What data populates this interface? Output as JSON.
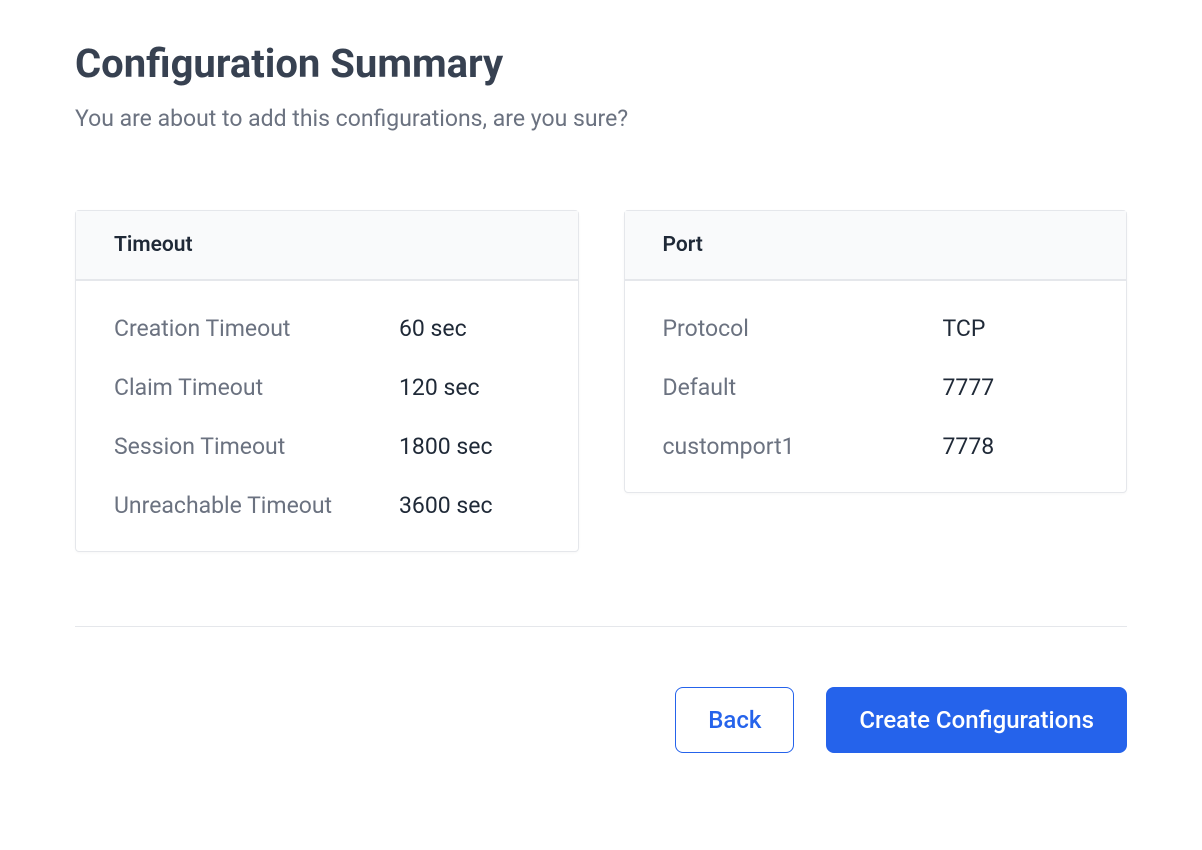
{
  "header": {
    "title": "Configuration Summary",
    "subtitle": "You are about to add this configurations, are you sure?"
  },
  "timeout_card": {
    "title": "Timeout",
    "rows": [
      {
        "label": "Creation Timeout",
        "value": "60 sec"
      },
      {
        "label": "Claim Timeout",
        "value": "120 sec"
      },
      {
        "label": "Session Timeout",
        "value": "1800 sec"
      },
      {
        "label": "Unreachable Timeout",
        "value": "3600 sec"
      }
    ]
  },
  "port_card": {
    "title": "Port",
    "rows": [
      {
        "label": "Protocol",
        "value": "TCP"
      },
      {
        "label": "Default",
        "value": "7777"
      },
      {
        "label": "customport1",
        "value": "7778"
      }
    ]
  },
  "footer": {
    "back_label": "Back",
    "submit_label": "Create Configurations"
  }
}
